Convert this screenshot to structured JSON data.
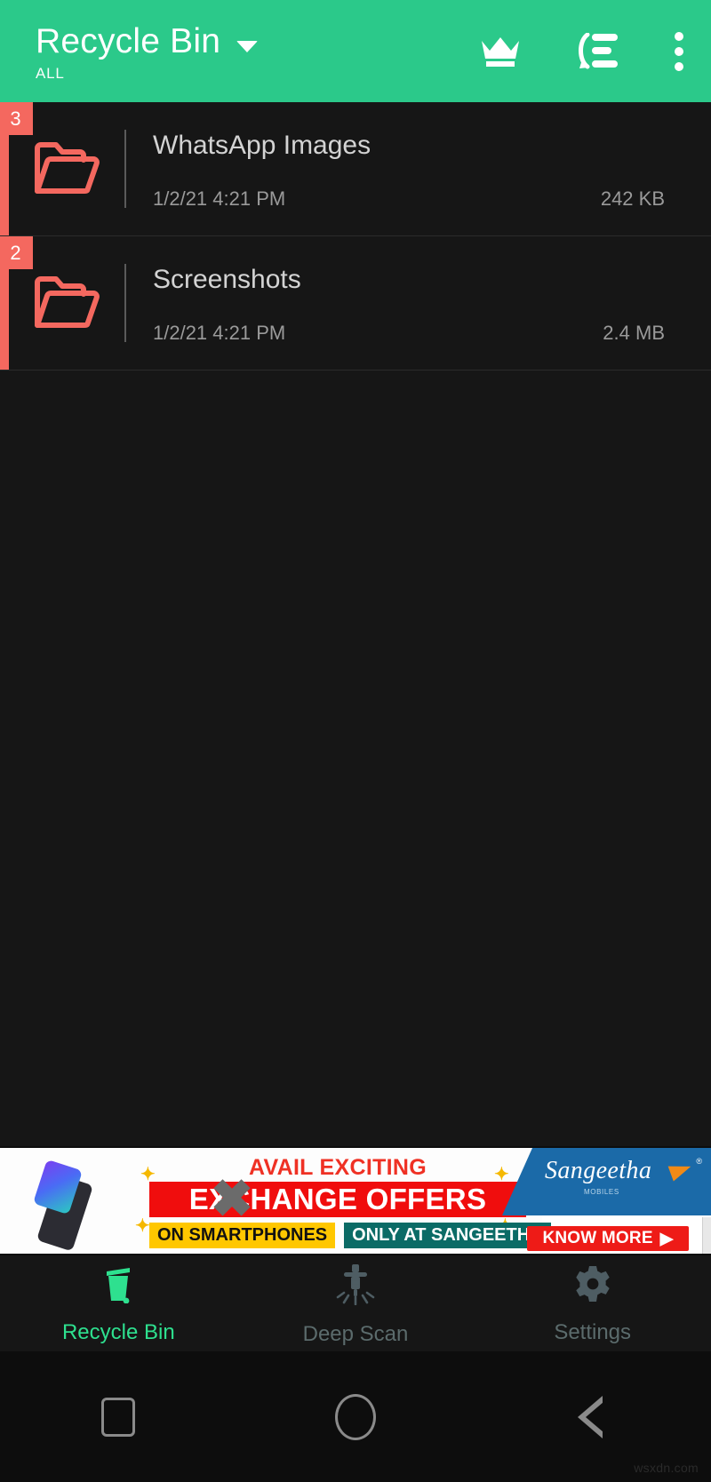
{
  "appbar": {
    "title": "Recycle Bin",
    "subtitle": "ALL",
    "dropdown_icon": "chevron-down-icon",
    "actions": [
      {
        "name": "crown-premium-icon",
        "label": "Premium"
      },
      {
        "name": "restore-list-icon",
        "label": "Restore"
      },
      {
        "name": "overflow-menu-icon",
        "label": "More options"
      }
    ]
  },
  "colors": {
    "accent_green": "#2bc98a",
    "tab_active_green": "#2ee08f",
    "folder_red": "#f4685f",
    "badge_red": "#f4685f",
    "background": "#161616",
    "text_primary": "#d3d3d3",
    "text_secondary": "#9a9a9a"
  },
  "list": {
    "items": [
      {
        "badge": "3",
        "icon": "folder-open-icon",
        "name": "WhatsApp Images",
        "date": "1/2/21 4:21 PM",
        "size": "242 KB"
      },
      {
        "badge": "2",
        "icon": "folder-open-icon",
        "name": "Screenshots",
        "date": "1/2/21 4:21 PM",
        "size": "2.4 MB"
      }
    ]
  },
  "ad": {
    "headline": "AVAIL EXCITING",
    "main_text": "EXCHANGE OFFERS",
    "tag_left": "ON SMARTPHONES",
    "tag_right": "ONLY AT SANGEETHA",
    "brand": "Sangeetha",
    "brand_sub": "MOBILES",
    "cta": "KNOW MORE",
    "cta_arrow": "▶"
  },
  "tabbar": {
    "items": [
      {
        "icon": "trash-bin-icon",
        "label": "Recycle Bin",
        "active": true
      },
      {
        "icon": "deep-scan-drill-icon",
        "label": "Deep Scan",
        "active": false
      },
      {
        "icon": "gear-icon",
        "label": "Settings",
        "active": false
      }
    ]
  },
  "sysnav": {
    "recents": "recents-square-icon",
    "home": "home-circle-icon",
    "back": "back-triangle-icon"
  },
  "watermark": "wsxdn.com"
}
